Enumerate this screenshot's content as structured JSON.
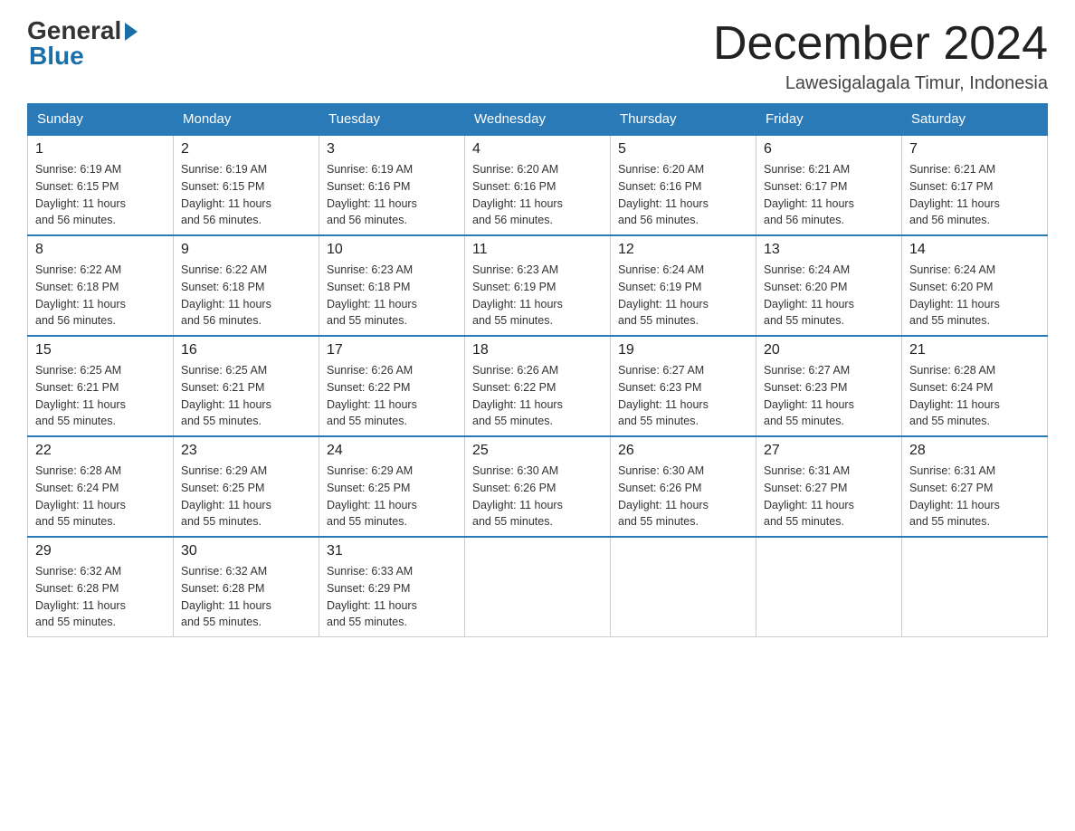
{
  "header": {
    "logo_general": "General",
    "logo_blue": "Blue",
    "month_title": "December 2024",
    "location": "Lawesigalagala Timur, Indonesia"
  },
  "days_of_week": [
    "Sunday",
    "Monday",
    "Tuesday",
    "Wednesday",
    "Thursday",
    "Friday",
    "Saturday"
  ],
  "weeks": [
    [
      {
        "day": "1",
        "sunrise": "6:19 AM",
        "sunset": "6:15 PM",
        "daylight": "11 hours and 56 minutes."
      },
      {
        "day": "2",
        "sunrise": "6:19 AM",
        "sunset": "6:15 PM",
        "daylight": "11 hours and 56 minutes."
      },
      {
        "day": "3",
        "sunrise": "6:19 AM",
        "sunset": "6:16 PM",
        "daylight": "11 hours and 56 minutes."
      },
      {
        "day": "4",
        "sunrise": "6:20 AM",
        "sunset": "6:16 PM",
        "daylight": "11 hours and 56 minutes."
      },
      {
        "day": "5",
        "sunrise": "6:20 AM",
        "sunset": "6:16 PM",
        "daylight": "11 hours and 56 minutes."
      },
      {
        "day": "6",
        "sunrise": "6:21 AM",
        "sunset": "6:17 PM",
        "daylight": "11 hours and 56 minutes."
      },
      {
        "day": "7",
        "sunrise": "6:21 AM",
        "sunset": "6:17 PM",
        "daylight": "11 hours and 56 minutes."
      }
    ],
    [
      {
        "day": "8",
        "sunrise": "6:22 AM",
        "sunset": "6:18 PM",
        "daylight": "11 hours and 56 minutes."
      },
      {
        "day": "9",
        "sunrise": "6:22 AM",
        "sunset": "6:18 PM",
        "daylight": "11 hours and 56 minutes."
      },
      {
        "day": "10",
        "sunrise": "6:23 AM",
        "sunset": "6:18 PM",
        "daylight": "11 hours and 55 minutes."
      },
      {
        "day": "11",
        "sunrise": "6:23 AM",
        "sunset": "6:19 PM",
        "daylight": "11 hours and 55 minutes."
      },
      {
        "day": "12",
        "sunrise": "6:24 AM",
        "sunset": "6:19 PM",
        "daylight": "11 hours and 55 minutes."
      },
      {
        "day": "13",
        "sunrise": "6:24 AM",
        "sunset": "6:20 PM",
        "daylight": "11 hours and 55 minutes."
      },
      {
        "day": "14",
        "sunrise": "6:24 AM",
        "sunset": "6:20 PM",
        "daylight": "11 hours and 55 minutes."
      }
    ],
    [
      {
        "day": "15",
        "sunrise": "6:25 AM",
        "sunset": "6:21 PM",
        "daylight": "11 hours and 55 minutes."
      },
      {
        "day": "16",
        "sunrise": "6:25 AM",
        "sunset": "6:21 PM",
        "daylight": "11 hours and 55 minutes."
      },
      {
        "day": "17",
        "sunrise": "6:26 AM",
        "sunset": "6:22 PM",
        "daylight": "11 hours and 55 minutes."
      },
      {
        "day": "18",
        "sunrise": "6:26 AM",
        "sunset": "6:22 PM",
        "daylight": "11 hours and 55 minutes."
      },
      {
        "day": "19",
        "sunrise": "6:27 AM",
        "sunset": "6:23 PM",
        "daylight": "11 hours and 55 minutes."
      },
      {
        "day": "20",
        "sunrise": "6:27 AM",
        "sunset": "6:23 PM",
        "daylight": "11 hours and 55 minutes."
      },
      {
        "day": "21",
        "sunrise": "6:28 AM",
        "sunset": "6:24 PM",
        "daylight": "11 hours and 55 minutes."
      }
    ],
    [
      {
        "day": "22",
        "sunrise": "6:28 AM",
        "sunset": "6:24 PM",
        "daylight": "11 hours and 55 minutes."
      },
      {
        "day": "23",
        "sunrise": "6:29 AM",
        "sunset": "6:25 PM",
        "daylight": "11 hours and 55 minutes."
      },
      {
        "day": "24",
        "sunrise": "6:29 AM",
        "sunset": "6:25 PM",
        "daylight": "11 hours and 55 minutes."
      },
      {
        "day": "25",
        "sunrise": "6:30 AM",
        "sunset": "6:26 PM",
        "daylight": "11 hours and 55 minutes."
      },
      {
        "day": "26",
        "sunrise": "6:30 AM",
        "sunset": "6:26 PM",
        "daylight": "11 hours and 55 minutes."
      },
      {
        "day": "27",
        "sunrise": "6:31 AM",
        "sunset": "6:27 PM",
        "daylight": "11 hours and 55 minutes."
      },
      {
        "day": "28",
        "sunrise": "6:31 AM",
        "sunset": "6:27 PM",
        "daylight": "11 hours and 55 minutes."
      }
    ],
    [
      {
        "day": "29",
        "sunrise": "6:32 AM",
        "sunset": "6:28 PM",
        "daylight": "11 hours and 55 minutes."
      },
      {
        "day": "30",
        "sunrise": "6:32 AM",
        "sunset": "6:28 PM",
        "daylight": "11 hours and 55 minutes."
      },
      {
        "day": "31",
        "sunrise": "6:33 AM",
        "sunset": "6:29 PM",
        "daylight": "11 hours and 55 minutes."
      },
      null,
      null,
      null,
      null
    ]
  ],
  "labels": {
    "sunrise": "Sunrise:",
    "sunset": "Sunset:",
    "daylight": "Daylight:"
  }
}
